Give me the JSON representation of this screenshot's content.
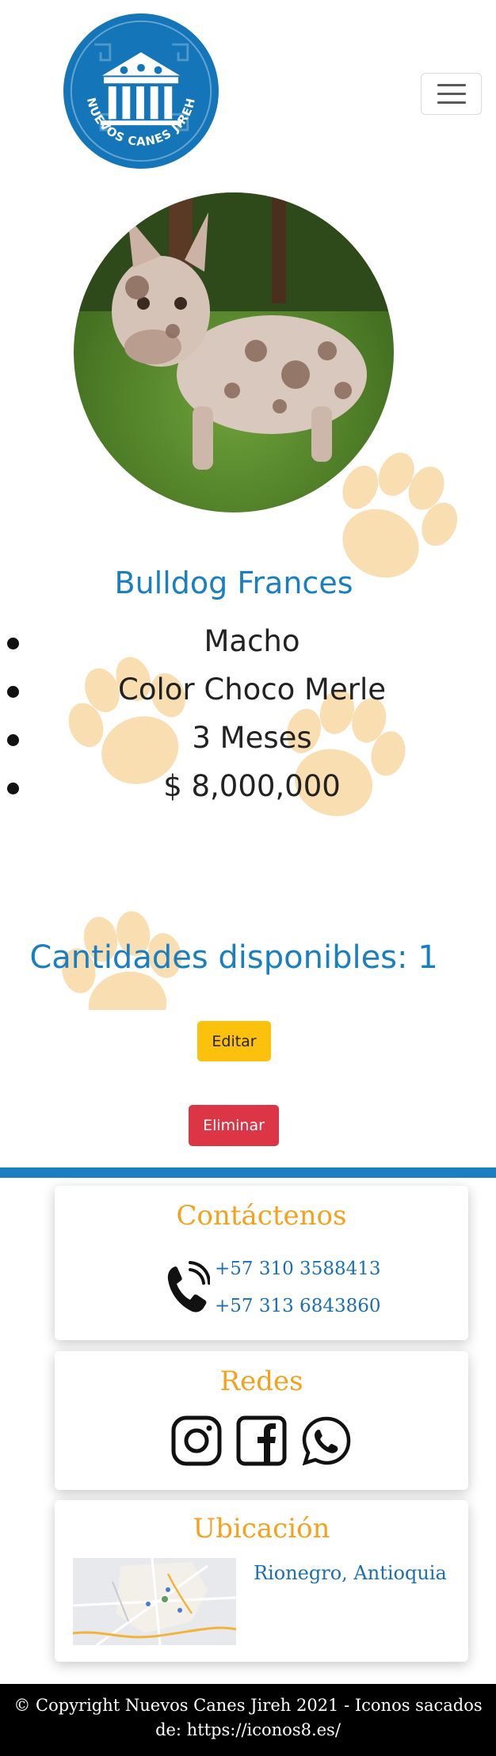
{
  "header": {
    "logo_text": "NUEVOS CANES JIREH",
    "menu_icon": "hamburger-icon"
  },
  "pet": {
    "name": "Bulldog Frances",
    "details": [
      "Macho",
      "Color Choco Merle",
      "3 Meses",
      "$ 8,000,000"
    ]
  },
  "stock": {
    "text": "Cantidades disponibles: 1"
  },
  "actions": {
    "edit_label": "Editar",
    "delete_label": "Eliminar"
  },
  "contact": {
    "title": "Contáctenos",
    "phones": [
      "+57 310 3588413",
      "+57 313 6843860"
    ],
    "icon": "phone-icon"
  },
  "social": {
    "title": "Redes",
    "icons": [
      "instagram-icon",
      "facebook-icon",
      "whatsapp-icon"
    ]
  },
  "location": {
    "title": "Ubicación",
    "text": "Rionegro, Antioquia"
  },
  "footer": {
    "text": "© Copyright Nuevos Canes Jireh 2021 - Iconos sacados de: https://iconos8.es/"
  },
  "colors": {
    "brand_blue": "#1a7fc1",
    "accent_orange": "#f4a11d",
    "edit_yellow": "#fbc10d",
    "delete_red": "#dc3545",
    "paw_cream": "#f8deb0"
  }
}
